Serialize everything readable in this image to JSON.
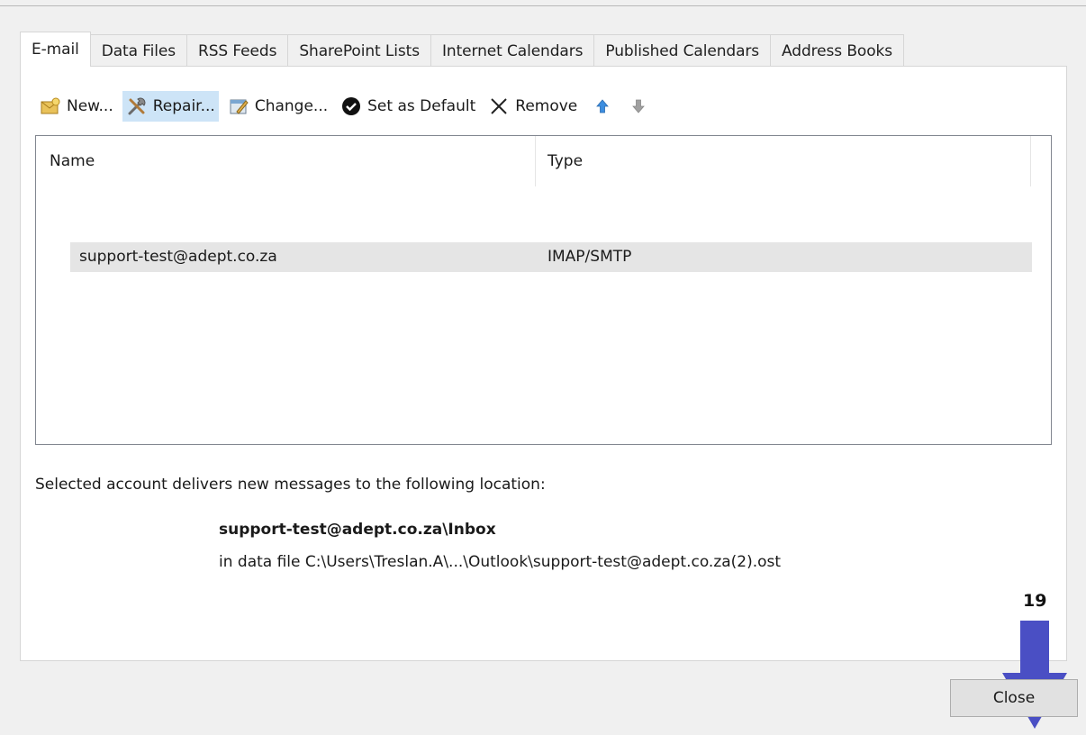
{
  "tabs": [
    "E-mail",
    "Data Files",
    "RSS Feeds",
    "SharePoint Lists",
    "Internet Calendars",
    "Published Calendars",
    "Address Books"
  ],
  "toolbar": {
    "new_label": "New...",
    "repair_label": "Repair...",
    "change_label": "Change...",
    "set_default_label": "Set as Default",
    "remove_label": "Remove"
  },
  "list": {
    "columns": [
      "Name",
      "Type"
    ],
    "rows": [
      {
        "name": "support-test@adept.co.za",
        "type": "IMAP/SMTP"
      }
    ]
  },
  "delivery": {
    "label": "Selected account delivers new messages to the following location:",
    "folder": "support-test@adept.co.za\\Inbox",
    "data_file": "in data file C:\\Users\\Treslan.A\\...\\Outlook\\support-test@adept.co.za(2).ost"
  },
  "annotation": {
    "step_number": "19",
    "arrow_color": "#4a4fc4"
  },
  "close_label": "Close",
  "colors": {
    "hover_button": "#cde4f7",
    "selected_row": "#e5e5e5",
    "arrow_up": "#3d8ee0",
    "arrow_down_disabled": "#a0a0a0"
  }
}
